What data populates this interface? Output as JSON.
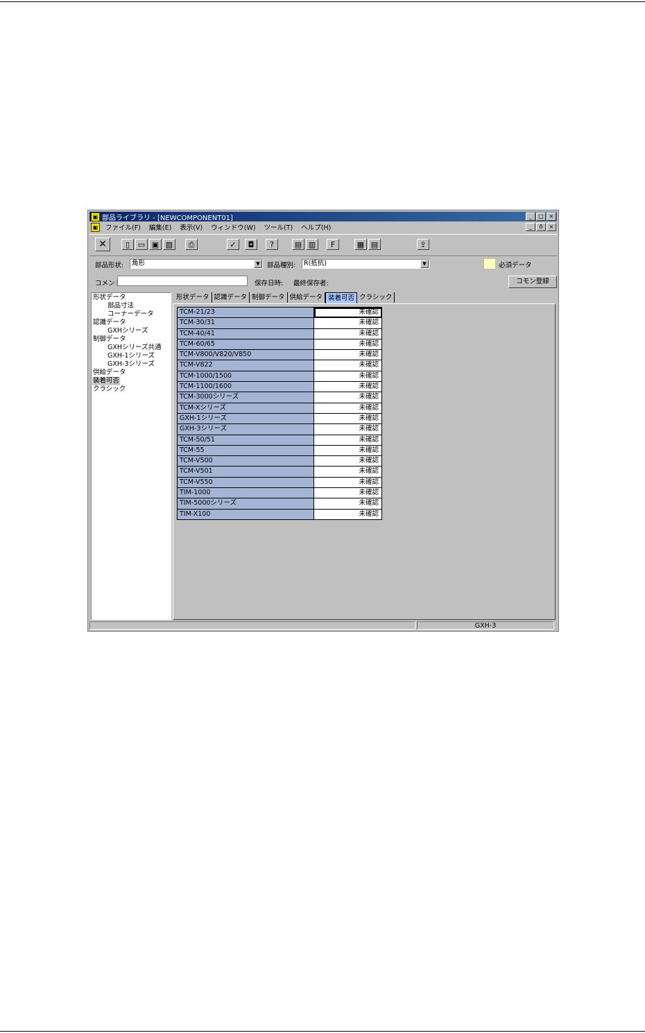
{
  "window": {
    "title": "部品ライブラリ - [NEWCOMPONENT01]",
    "app_icon": "library-icon",
    "controls": [
      "_",
      "□",
      "×"
    ],
    "mdi_controls": [
      "_",
      "ð",
      "×"
    ]
  },
  "menu": [
    "ファイル(F)",
    "編集(E)",
    "表示(V)",
    "ウィンドウ(W)",
    "ツール(T)",
    "ヘルプ(H)"
  ],
  "toolbar": {
    "close_glyph": "✕",
    "new_glyph": "▯",
    "open_glyph": "▭",
    "save_glyph": "▣",
    "saveas_glyph": "▧",
    "print_glyph": "⎙",
    "check_glyph": "✓",
    "insert_glyph": "◘",
    "help_glyph": "?",
    "view1_glyph": "▤",
    "view2_glyph": "▥",
    "font_glyph": "F",
    "win1_glyph": "▦",
    "win2_glyph": "▤",
    "export_glyph": "⇪"
  },
  "form": {
    "shape_label": "部品形状:",
    "shape_value": "角形",
    "kind_label": "部品種別:",
    "kind_value": "R(抵抗)",
    "required_label": "必須データ",
    "comment_label": "コメント:",
    "comment_value": "",
    "saved_date_label": "保存日時:",
    "last_saver_label": "最終保存者:",
    "common_register_button": "コモン登録"
  },
  "tree": {
    "nodes": [
      {
        "label": "形状データ",
        "level": 0
      },
      {
        "label": "部品寸法",
        "level": 1
      },
      {
        "label": "コーナーデータ",
        "level": 1
      },
      {
        "label": "認識データ",
        "level": 0
      },
      {
        "label": "GXHシリーズ",
        "level": 1
      },
      {
        "label": "制御データ",
        "level": 0
      },
      {
        "label": "GXHシリーズ共通",
        "level": 1
      },
      {
        "label": "GXH-1シリーズ",
        "level": 1
      },
      {
        "label": "GXH-3シリーズ",
        "level": 1
      },
      {
        "label": "供給データ",
        "level": 0
      },
      {
        "label": "装着可否",
        "level": 0,
        "selected": true
      },
      {
        "label": "クラシック",
        "level": 0
      }
    ]
  },
  "tabs": [
    "形状データ",
    "認識データ",
    "制御データ",
    "供給データ",
    "装着可否",
    "クラシック"
  ],
  "active_tab": "装着可否",
  "grid": {
    "rows": [
      {
        "machine": "TCM-21/23",
        "status": "未確認"
      },
      {
        "machine": "TCM-30/31",
        "status": "未確認"
      },
      {
        "machine": "TCM-40/41",
        "status": "未確認"
      },
      {
        "machine": "TCM-60/65",
        "status": "未確認"
      },
      {
        "machine": "TCM-V800/V820/V850",
        "status": "未確認"
      },
      {
        "machine": "TCM-V822",
        "status": "未確認"
      },
      {
        "machine": "TCM-1000/1500",
        "status": "未確認"
      },
      {
        "machine": "TCM-1100/1600",
        "status": "未確認"
      },
      {
        "machine": "TCM-3000シリーズ",
        "status": "未確認"
      },
      {
        "machine": "TCM-Xシリーズ",
        "status": "未確認"
      },
      {
        "machine": "GXH-1シリーズ",
        "status": "未確認"
      },
      {
        "machine": "GXH-3シリーズ",
        "status": "未確認"
      },
      {
        "machine": "TCM-50/51",
        "status": "未確認"
      },
      {
        "machine": "TCM-55",
        "status": "未確認"
      },
      {
        "machine": "TCM-V500",
        "status": "未確認"
      },
      {
        "machine": "TCM-V501",
        "status": "未確認"
      },
      {
        "machine": "TCM-V550",
        "status": "未確認"
      },
      {
        "machine": "TIM-1000",
        "status": "未確認"
      },
      {
        "machine": "TIM-5000シリーズ",
        "status": "未確認"
      },
      {
        "machine": "TIM-X100",
        "status": "未確認"
      }
    ]
  },
  "status": {
    "panel1": "",
    "panel2": "GXH-3"
  },
  "colors": {
    "title_bar": "#0a246a",
    "grid_name_cell": "#a4b4d4",
    "active_tab": "#a8c8ff",
    "required_swatch": "#ffffc0"
  }
}
